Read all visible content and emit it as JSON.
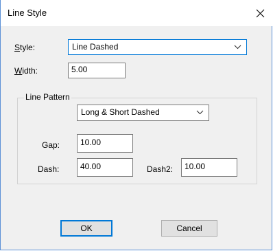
{
  "dialog": {
    "title": "Line Style"
  },
  "style": {
    "label_underlined": "S",
    "label_rest": "tyle:",
    "value": "Line Dashed"
  },
  "width": {
    "label_underlined": "W",
    "label_rest": "idth:",
    "value": "5.00"
  },
  "pattern": {
    "group_label": "Line Pattern",
    "value": "Long & Short Dashed",
    "gap_label": "Gap:",
    "gap_value": "10.00",
    "dash_label": "Dash:",
    "dash_value": "40.00",
    "dash2_label": "Dash2:",
    "dash2_value": "10.00"
  },
  "buttons": {
    "ok": "OK",
    "cancel": "Cancel"
  },
  "icons": {
    "close": "close-icon",
    "dropdown": "chevron-down-icon"
  }
}
